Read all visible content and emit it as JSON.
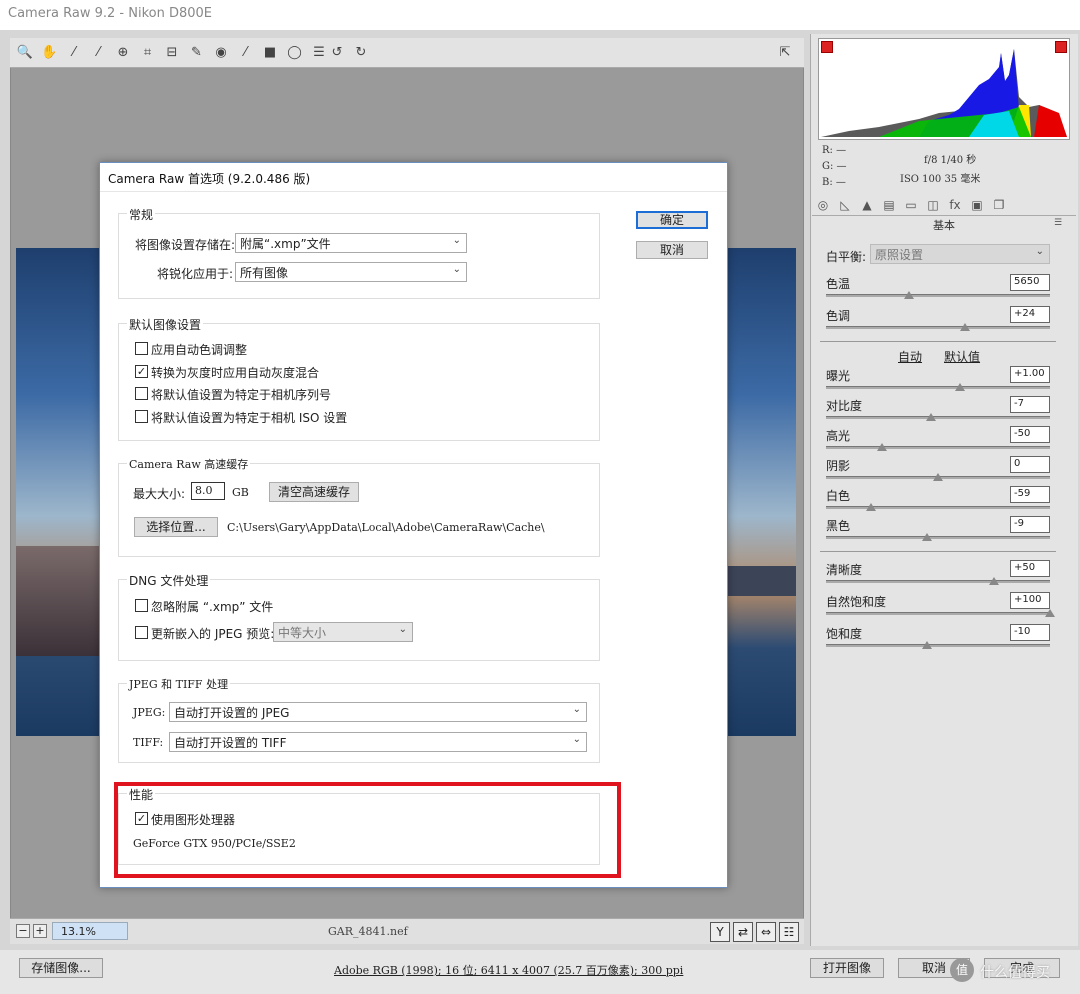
{
  "window": {
    "title": "Camera Raw 9.2 -  Nikon D800E"
  },
  "toolbar": {
    "tools": [
      {
        "name": "zoom-tool-icon",
        "glyph": "🔍"
      },
      {
        "name": "hand-tool-icon",
        "glyph": "✋"
      },
      {
        "name": "white-balance-tool-icon",
        "glyph": "⁄"
      },
      {
        "name": "color-sampler-icon",
        "glyph": "⁄"
      },
      {
        "name": "target-adjust-icon",
        "glyph": "⊕"
      },
      {
        "name": "crop-tool-icon",
        "glyph": "⌗"
      },
      {
        "name": "straighten-tool-icon",
        "glyph": "⊟"
      },
      {
        "name": "spot-removal-icon",
        "glyph": "✎"
      },
      {
        "name": "red-eye-icon",
        "glyph": "◉"
      },
      {
        "name": "adjustment-brush-icon",
        "glyph": "⁄"
      },
      {
        "name": "graduated-filter-icon",
        "glyph": "■"
      },
      {
        "name": "radial-filter-icon",
        "glyph": "◯"
      },
      {
        "name": "preferences-icon",
        "glyph": "☰"
      },
      {
        "name": "rotate-left-icon",
        "glyph": "↺"
      },
      {
        "name": "rotate-right-icon",
        "glyph": "↻"
      }
    ],
    "fullscreen_glyph": "⇱"
  },
  "bottom": {
    "zoom_out": "−",
    "zoom_in": "+",
    "zoom": "13.1%",
    "filename": "GAR_4841.nef",
    "view_buttons": [
      "Y",
      "⇄",
      "⇔",
      "☷"
    ]
  },
  "histogram": {
    "rgb": {
      "r": "R:  —",
      "g": "G:  —",
      "b": "B:  —"
    },
    "aperture_shutter": "f/8  1/40 秒",
    "iso_focal": "ISO 100  35 毫米"
  },
  "panel": {
    "title": "基本",
    "menu_glyph": "☰",
    "tabs": [
      "◎",
      "◺",
      "▲",
      "▤",
      "▭",
      "◫",
      "fx",
      "▣",
      "❐"
    ],
    "white_balance_label": "白平衡:",
    "white_balance_value": "原照设置",
    "auto_link": "自动",
    "default_link": "默认值",
    "sliders": [
      {
        "label": "色温",
        "value": "5650",
        "pos": 0.37
      },
      {
        "label": "色调",
        "value": "+24",
        "pos": 0.62
      },
      {
        "label": "曝光",
        "value": "+1.00",
        "pos": 0.6
      },
      {
        "label": "对比度",
        "value": "-7",
        "pos": 0.47
      },
      {
        "label": "高光",
        "value": "-50",
        "pos": 0.25
      },
      {
        "label": "阴影",
        "value": "0",
        "pos": 0.5
      },
      {
        "label": "白色",
        "value": "-59",
        "pos": 0.2
      },
      {
        "label": "黑色",
        "value": "-9",
        "pos": 0.45
      },
      {
        "label": "清晰度",
        "value": "+50",
        "pos": 0.75
      },
      {
        "label": "自然饱和度",
        "value": "+100",
        "pos": 1.0
      },
      {
        "label": "饱和度",
        "value": "-10",
        "pos": 0.45
      }
    ]
  },
  "footer": {
    "save_label": "存储图像...",
    "info_link": "Adobe RGB (1998); 16 位; 6411 x 4007 (25.7 百万像素); 300 ppi",
    "open_label": "打开图像",
    "cancel_label": "取消",
    "done_label": "完成",
    "watermark_text": "什么值得买",
    "watermark_logo": "值"
  },
  "dialog": {
    "title": "Camera Raw 首选项  (9.2.0.486 版)",
    "ok_label": "确定",
    "cancel_label": "取消",
    "general": {
      "title": "常规",
      "save_settings_label": "将图像设置存储在:",
      "save_settings_value": "附属“.xmp”文件",
      "sharpen_label": "将锐化应用于:",
      "sharpen_value": "所有图像"
    },
    "defaults": {
      "title": "默认图像设置",
      "items": [
        {
          "label": "应用自动色调调整",
          "checked": false
        },
        {
          "label": "转换为灰度时应用自动灰度混合",
          "checked": true
        },
        {
          "label": "将默认值设置为特定于相机序列号",
          "checked": false
        },
        {
          "label": "将默认值设置为特定于相机 ISO 设置",
          "checked": false
        }
      ]
    },
    "cache": {
      "title": "Camera Raw 高速缓存",
      "max_size_label": "最大大小:",
      "max_size_value": "8.0",
      "unit": "GB",
      "purge_label": "清空高速缓存",
      "select_label": "选择位置...",
      "path": "C:\\Users\\Gary\\AppData\\Local\\Adobe\\CameraRaw\\Cache\\"
    },
    "dng": {
      "title": "DNG 文件处理",
      "ignore_label": "忽略附属 “.xmp” 文件",
      "update_label": "更新嵌入的 JPEG 预览:",
      "preview_value": "中等大小"
    },
    "jpeg_tiff": {
      "title": "JPEG 和 TIFF 处理",
      "jpeg_label": "JPEG:",
      "jpeg_value": "自动打开设置的 JPEG",
      "tiff_label": "TIFF:",
      "tiff_value": "自动打开设置的 TIFF"
    },
    "performance": {
      "title": "性能",
      "gpu_label": "使用图形处理器",
      "gpu_checked": true,
      "gpu_name": "GeForce GTX 950/PCIe/SSE2"
    }
  },
  "check_glyph": "✓",
  "chevron_glyph": "⌄"
}
